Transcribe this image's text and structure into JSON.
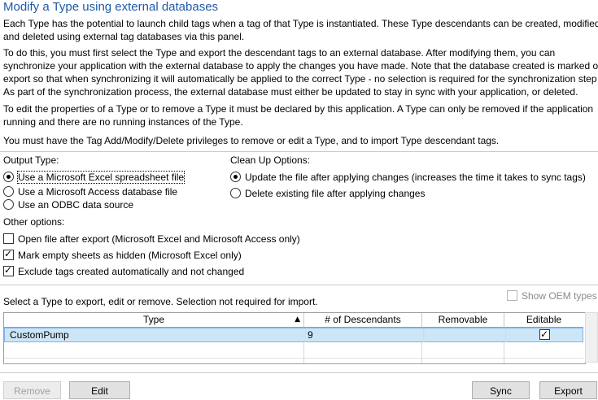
{
  "title": "Modify a Type using external databases",
  "paragraphs": {
    "p1": [
      "Each Type has the potential to launch child tags when a tag of that Type is instantiated. These Type descendants can be created, modified,",
      "and deleted using external tag databases via this panel."
    ],
    "p2": [
      "To do this, you must first select the Type and export the descendant tags to an external database. After modifying them, you can",
      "synchronize your application with the external database to apply the changes you have made. Note that the database created is marked on",
      "export so that when synchronizing it will automatically be applied to the correct Type - no selection is required for the synchronization step",
      "As part of the synchronization process, the external database must either be updated to stay in sync with your application, or deleted."
    ],
    "p3": [
      "To edit the properties of a Type or to remove a Type it must be declared by this application. A Type can only be removed if the application",
      "running and there are no running instances of the Type."
    ],
    "p4": [
      "You must have the Tag Add/Modify/Delete privileges to remove or edit a Type, and to import Type descendant tags."
    ]
  },
  "output_type": {
    "label": "Output Type:",
    "options": [
      "Use a Microsoft Excel spreadsheet file",
      "Use a Microsoft Access database file",
      "Use an ODBC data source"
    ],
    "selected": 0
  },
  "cleanup": {
    "label": "Clean Up Options:",
    "options": [
      "Update the file after applying changes (increases the time it takes to sync tags)",
      "Delete existing file after applying changes"
    ],
    "selected": 0
  },
  "other": {
    "label": "Other options:",
    "options": [
      {
        "label": "Open file after export (Microsoft Excel and Microsoft Access only)",
        "checked": false
      },
      {
        "label": "Mark empty sheets as hidden (Microsoft Excel only)",
        "checked": true
      },
      {
        "label": "Exclude tags created automatically and not changed",
        "checked": true
      }
    ]
  },
  "select_hint": "Select a Type to export, edit or remove. Selection not required for import.",
  "show_oem": {
    "label": "Show OEM types",
    "checked": false
  },
  "grid": {
    "columns": [
      "Type",
      "# of Descendants",
      "Removable",
      "Editable"
    ],
    "sort_icon": "sort-up-icon",
    "rows": [
      {
        "type": "CustomPump",
        "descendants": "9",
        "removable": "",
        "editable": true
      }
    ]
  },
  "buttons": {
    "remove": "Remove",
    "edit": "Edit",
    "sync": "Sync",
    "export": "Export"
  },
  "colors": {
    "title": "#1e5aa6",
    "selection": "#cde6f7"
  }
}
